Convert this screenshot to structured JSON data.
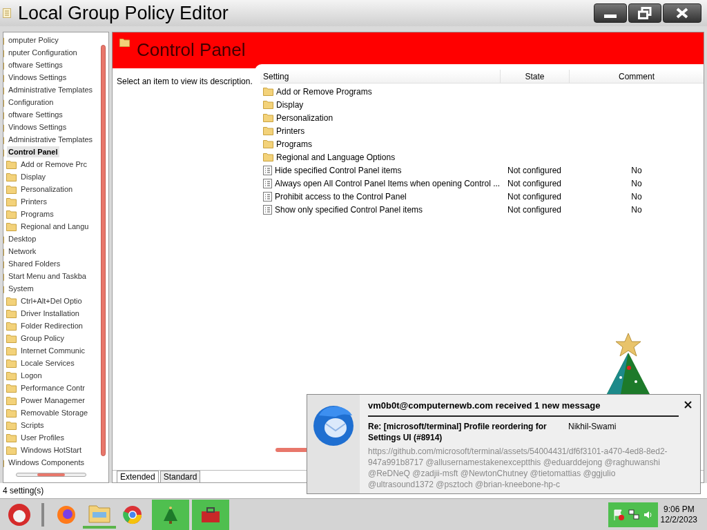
{
  "window": {
    "title": "Local Group Policy Editor"
  },
  "tree": {
    "items": [
      {
        "label": "omputer Policy",
        "selected": false
      },
      {
        "label": "nputer Configuration",
        "selected": false
      },
      {
        "label": "oftware Settings",
        "selected": false
      },
      {
        "label": "Vindows Settings",
        "selected": false
      },
      {
        "label": "Administrative Templates",
        "selected": false
      },
      {
        "label": " Configuration",
        "selected": false
      },
      {
        "label": "oftware Settings",
        "selected": false
      },
      {
        "label": "Vindows Settings",
        "selected": false
      },
      {
        "label": "Administrative Templates",
        "selected": false
      },
      {
        "label": "Control Panel",
        "selected": true,
        "children": [
          {
            "label": "Add or Remove Prc",
            "selected": false
          },
          {
            "label": "Display",
            "selected": false
          },
          {
            "label": "Personalization",
            "selected": false
          },
          {
            "label": "Printers",
            "selected": false
          },
          {
            "label": "Programs",
            "selected": false
          },
          {
            "label": "Regional and Langu",
            "selected": false
          }
        ]
      },
      {
        "label": "Desktop",
        "selected": false
      },
      {
        "label": "Network",
        "selected": false
      },
      {
        "label": "Shared Folders",
        "selected": false
      },
      {
        "label": "Start Menu and Taskba",
        "selected": false
      },
      {
        "label": "System",
        "selected": false,
        "children": [
          {
            "label": "Ctrl+Alt+Del Optio",
            "selected": false
          },
          {
            "label": "Driver Installation",
            "selected": false
          },
          {
            "label": "Folder Redirection",
            "selected": false
          },
          {
            "label": "Group Policy",
            "selected": false
          },
          {
            "label": "Internet Communic",
            "selected": false
          },
          {
            "label": "Locale Services",
            "selected": false
          },
          {
            "label": "Logon",
            "selected": false
          },
          {
            "label": "Performance Contr",
            "selected": false
          },
          {
            "label": "Power Managemer",
            "selected": false
          },
          {
            "label": "Removable Storage",
            "selected": false
          },
          {
            "label": "Scripts",
            "selected": false
          },
          {
            "label": "User Profiles",
            "selected": false
          },
          {
            "label": "Windows HotStart",
            "selected": false
          }
        ]
      },
      {
        "label": "Windows Components",
        "selected": false
      }
    ]
  },
  "header": {
    "title": "Control Panel"
  },
  "description": "Select an item to view its description.",
  "table": {
    "columns": [
      "Setting",
      "State",
      "Comment"
    ],
    "rows": [
      {
        "kind": "folder",
        "setting": "Add or Remove Programs"
      },
      {
        "kind": "folder",
        "setting": "Display"
      },
      {
        "kind": "folder",
        "setting": "Personalization"
      },
      {
        "kind": "folder",
        "setting": "Printers"
      },
      {
        "kind": "folder",
        "setting": "Programs"
      },
      {
        "kind": "folder",
        "setting": "Regional and Language Options"
      },
      {
        "kind": "policy",
        "setting": "Hide specified Control Panel items",
        "state": "Not configured",
        "comment": "No"
      },
      {
        "kind": "policy",
        "setting": "Always open All Control Panel Items when opening Control ...",
        "state": "Not configured",
        "comment": "No"
      },
      {
        "kind": "policy",
        "setting": "Prohibit access to the Control Panel",
        "state": "Not configured",
        "comment": "No"
      },
      {
        "kind": "policy",
        "setting": "Show only specified Control Panel items",
        "state": "Not configured",
        "comment": "No"
      }
    ]
  },
  "view_tabs": [
    {
      "label": "Extended",
      "selected": true
    },
    {
      "label": "Standard",
      "selected": false
    }
  ],
  "status_bar": "4 setting(s)",
  "notification": {
    "title": "vm0b0t@computernewb.com received 1 new message",
    "subject": "Re: [microsoft/terminal] Profile reordering for Settings UI (#8914)",
    "sender": "Nikhil-Swami",
    "body": "https://github.com/microsoft/terminal/assets/54004431/df6f3101-a470-4ed8-8ed2-947a991b8717 @allusernamestakenexceptthis @eduarddejong @raghuwanshi @ReDNeQ @zadjii-msft @NewtonChutney @tietomattias @ggjulio @ultrasound1372 @psztoch @brian-kneebone-hp-c"
  },
  "clock": {
    "time": "9:06 PM",
    "date": "12/2/2023"
  }
}
